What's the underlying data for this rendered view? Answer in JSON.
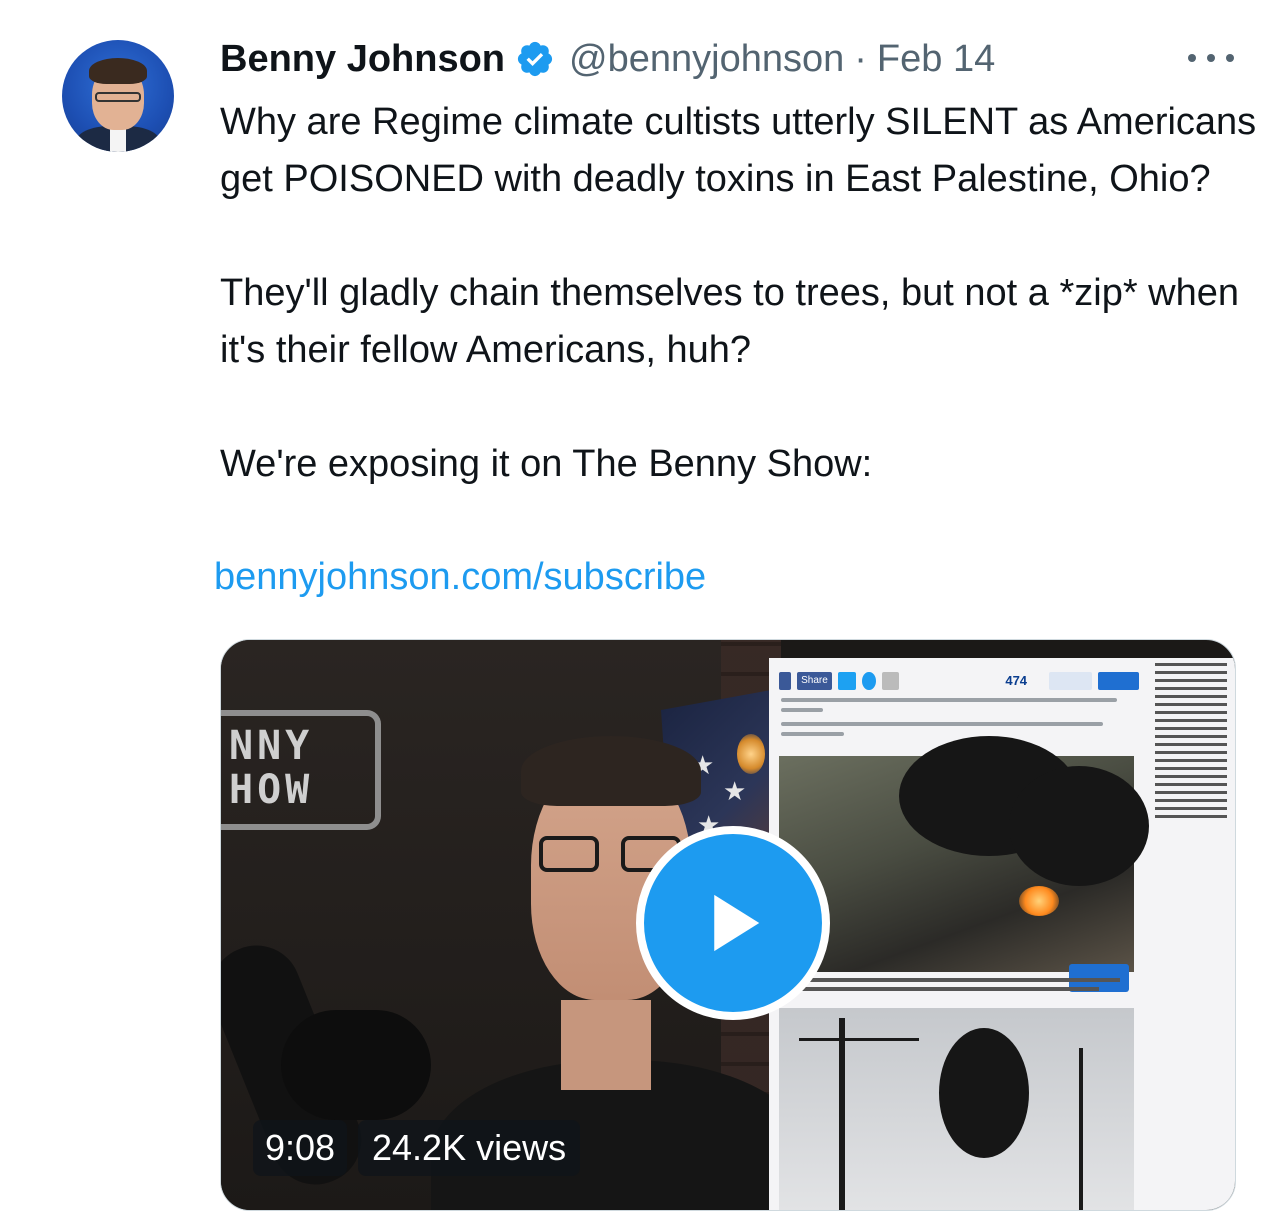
{
  "author": {
    "name": "Benny Johnson",
    "handle": "@bennyjohnson",
    "separator": "·",
    "date": "Feb 14"
  },
  "tweet": {
    "paragraph1": "Why are Regime climate cultists utterly SILENT as Americans get POISONED with deadly toxins in East Palestine, Ohio?",
    "paragraph2": "They'll gladly chain themselves to trees, but not a *zip* when it's their fellow Americans, huh?",
    "paragraph3": "We're exposing it on The Benny Show:",
    "link_text": "bennyjohnson.com/subscribe"
  },
  "video": {
    "duration": "9:08",
    "views": "24.2K views",
    "neon_sign": [
      "NNY",
      "HOW"
    ],
    "thumbnail_share_label": "Share",
    "thumbnail_comment_count": "474"
  },
  "icons": {
    "verified": "verified-badge-icon",
    "more": "more-options-icon",
    "play": "play-icon"
  },
  "colors": {
    "accent": "#1d9bf0",
    "text": "#0f1419",
    "secondary": "#536471"
  }
}
